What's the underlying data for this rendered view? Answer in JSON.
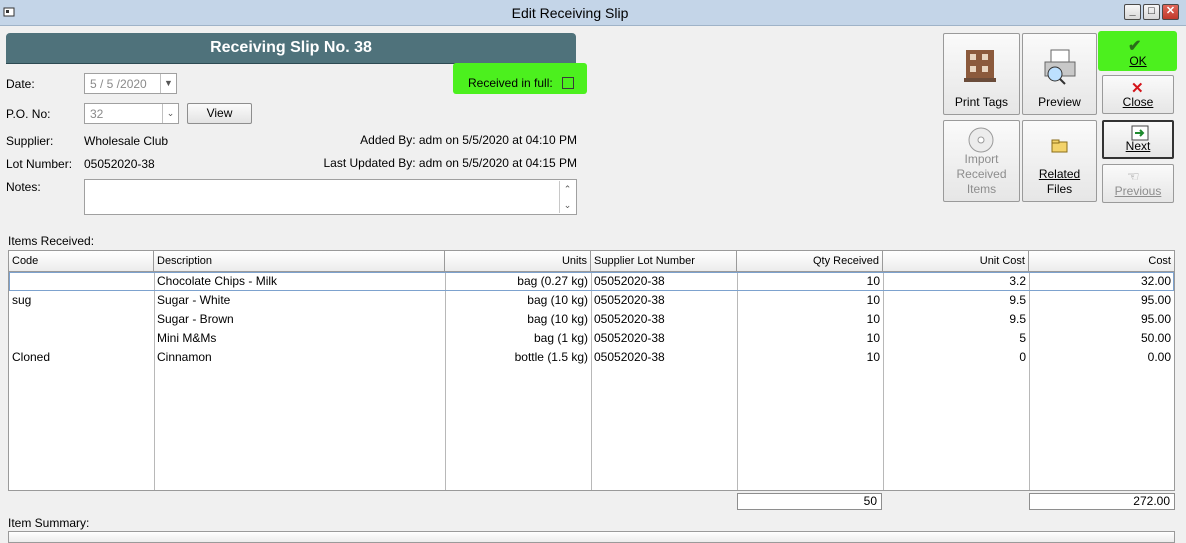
{
  "window": {
    "title": "Edit Receiving Slip"
  },
  "header": {
    "banner": "Receiving Slip No. 38"
  },
  "form": {
    "date_label": "Date:",
    "date_value": "5 / 5 /2020",
    "po_label": "P.O. No:",
    "po_value": "32",
    "view_label": "View",
    "supplier_label": "Supplier:",
    "supplier_value": "Wholesale Club",
    "lot_label": "Lot Number:",
    "lot_value": "05052020-38",
    "notes_label": "Notes:",
    "notes_value": "",
    "received_full_label": "Received in full:",
    "added_by": "Added By: adm on 5/5/2020 at 04:10 PM",
    "last_updated": "Last Updated By: adm on 5/5/2020 at 04:15 PM"
  },
  "toolbar": {
    "print_tags": "Print Tags",
    "preview": "Preview",
    "import_line1": "Import",
    "import_line2": "Received",
    "import_line3": "Items",
    "related_line1": "Related",
    "related_line2": "Files",
    "ok": "OK",
    "close": "Close",
    "next": "Next",
    "previous": "Previous"
  },
  "items": {
    "section_label": "Items Received:",
    "columns": [
      "Code",
      "Description",
      "Units",
      "Supplier Lot Number",
      "Qty Received",
      "Unit Cost",
      "Cost"
    ],
    "rows": [
      {
        "code": "",
        "description": "Chocolate Chips - Milk",
        "units": "bag (0.27 kg)",
        "lot": "05052020-38",
        "qty": "10",
        "unit_cost": "3.2",
        "cost": "32.00"
      },
      {
        "code": "sug",
        "description": "Sugar - White",
        "units": "bag (10 kg)",
        "lot": "05052020-38",
        "qty": "10",
        "unit_cost": "9.5",
        "cost": "95.00"
      },
      {
        "code": "",
        "description": "Sugar - Brown",
        "units": "bag (10 kg)",
        "lot": "05052020-38",
        "qty": "10",
        "unit_cost": "9.5",
        "cost": "95.00"
      },
      {
        "code": "",
        "description": "Mini M&Ms",
        "units": "bag (1 kg)",
        "lot": "05052020-38",
        "qty": "10",
        "unit_cost": "5",
        "cost": "50.00"
      },
      {
        "code": "Cloned",
        "description": "Cinnamon",
        "units": "bottle (1.5 kg)",
        "lot": "05052020-38",
        "qty": "10",
        "unit_cost": "0",
        "cost": "0.00"
      }
    ],
    "total_qty": "50",
    "total_cost": "272.00"
  },
  "summary": {
    "section_label": "Item Summary:"
  },
  "colors": {
    "ok_highlight": "#4cf01e",
    "banner": "#4f727b",
    "titlebar": "#c4d5e8"
  }
}
